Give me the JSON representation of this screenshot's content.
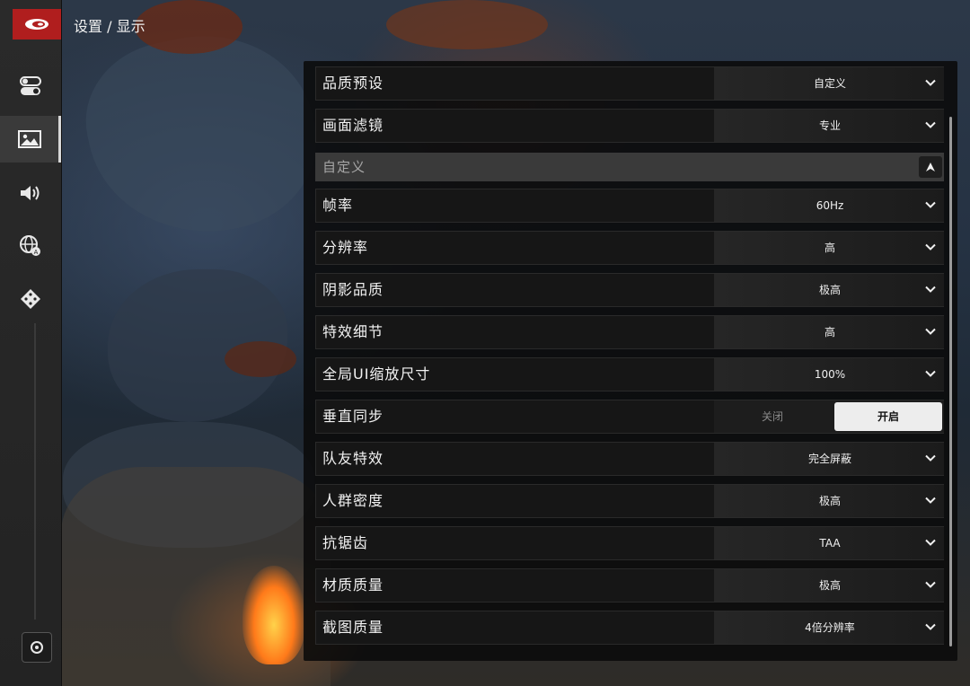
{
  "breadcrumb": "设置 / 显示",
  "sidebar": {
    "items": [
      {
        "icon": "toggle-icon"
      },
      {
        "icon": "image-icon",
        "active": true
      },
      {
        "icon": "speaker-icon"
      },
      {
        "icon": "globe-language-icon"
      },
      {
        "icon": "gamepad-icon"
      }
    ],
    "bottom_icon": "settings-gear-icon"
  },
  "settings": {
    "quality_preset": {
      "label": "品质预设",
      "value": "自定义"
    },
    "filter": {
      "label": "画面滤镜",
      "value": "专业"
    },
    "section_custom": {
      "label": "自定义"
    },
    "frame_rate": {
      "label": "帧率",
      "value": "60Hz"
    },
    "resolution": {
      "label": "分辨率",
      "value": "高"
    },
    "shadow_quality": {
      "label": "阴影品质",
      "value": "极高"
    },
    "effects_detail": {
      "label": "特效细节",
      "value": "高"
    },
    "ui_scale": {
      "label": "全局UI缩放尺寸",
      "value": "100%"
    },
    "vsync": {
      "label": "垂直同步",
      "off_label": "关闭",
      "on_label": "开启",
      "selected": "开启"
    },
    "teammate_effects": {
      "label": "队友特效",
      "value": "完全屏蔽"
    },
    "crowd_density": {
      "label": "人群密度",
      "value": "极高"
    },
    "anti_aliasing": {
      "label": "抗锯齿",
      "value": "TAA"
    },
    "texture_quality": {
      "label": "材质质量",
      "value": "极高"
    },
    "screenshot_quality": {
      "label": "截图质量",
      "value": "4倍分辨率"
    }
  },
  "colors": {
    "accent_logo": "#b01e1e",
    "toggle_active_bg": "#ededed"
  }
}
